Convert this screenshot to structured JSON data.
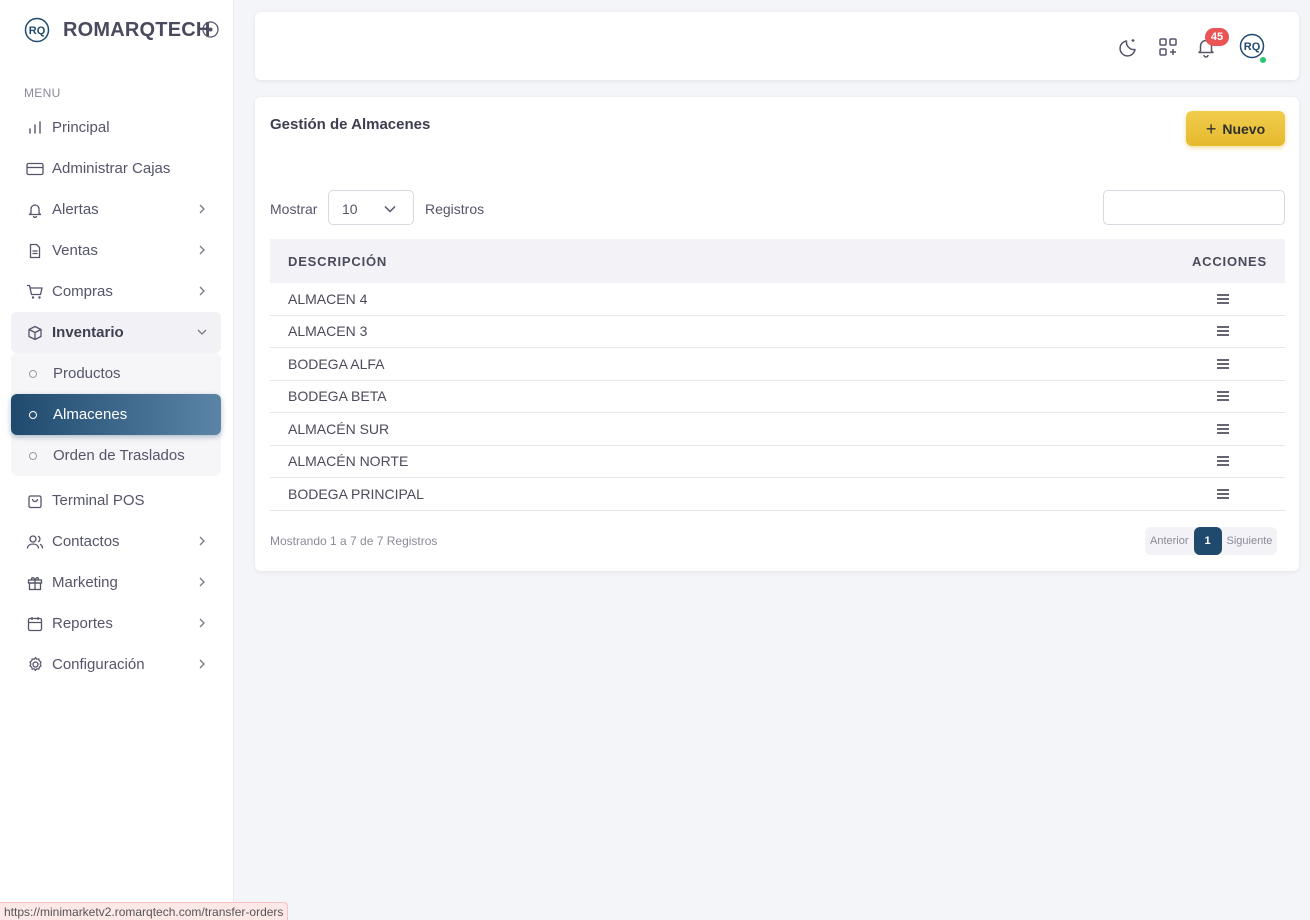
{
  "brand": {
    "name": "ROMARQTECH",
    "logo_text": "RQ"
  },
  "sidebar": {
    "menu_header": "MENU",
    "items": [
      {
        "label": "Principal",
        "icon": "bar-chart-icon"
      },
      {
        "label": "Administrar Cajas",
        "icon": "credit-card-icon"
      },
      {
        "label": "Alertas",
        "icon": "bell-icon"
      },
      {
        "label": "Ventas",
        "icon": "file-text-icon"
      },
      {
        "label": "Compras",
        "icon": "cart-icon"
      },
      {
        "label": "Inventario",
        "icon": "box-icon"
      }
    ],
    "inventario_sub": [
      {
        "label": "Productos"
      },
      {
        "label": "Almacenes"
      },
      {
        "label": "Orden de Traslados"
      }
    ],
    "items_after": [
      {
        "label": "Terminal POS",
        "icon": "shopping-bag-icon"
      },
      {
        "label": "Contactos",
        "icon": "users-icon"
      },
      {
        "label": "Marketing",
        "icon": "gift-icon"
      },
      {
        "label": "Reportes",
        "icon": "calendar-icon"
      },
      {
        "label": "Configuración",
        "icon": "settings-icon"
      }
    ]
  },
  "topbar": {
    "notification_count": "45"
  },
  "page": {
    "title": "Gestión de Almacenes",
    "new_button": "Nuevo",
    "show_label": "Mostrar",
    "page_size": "10",
    "records_label": "Registros",
    "search_value": ""
  },
  "table": {
    "columns": [
      "DESCRIPCIÓN",
      "ACCIONES"
    ],
    "rows": [
      "ALMACEN 4",
      "ALMACEN 3",
      "BODEGA ALFA",
      "BODEGA BETA",
      "ALMACÉN SUR",
      "ALMACÉN NORTE",
      "BODEGA PRINCIPAL"
    ]
  },
  "footer": {
    "info": "Mostrando 1 a 7 de 7 Registros",
    "prev": "Anterior",
    "current_page": "1",
    "next": "Siguiente"
  },
  "status_url": "https://minimarketv2.romarqtech.com/transfer-orders",
  "colors": {
    "primary": "#1f4a6e",
    "accent": "#e5b92c",
    "badge": "#ea5455",
    "online": "#28c76f"
  }
}
